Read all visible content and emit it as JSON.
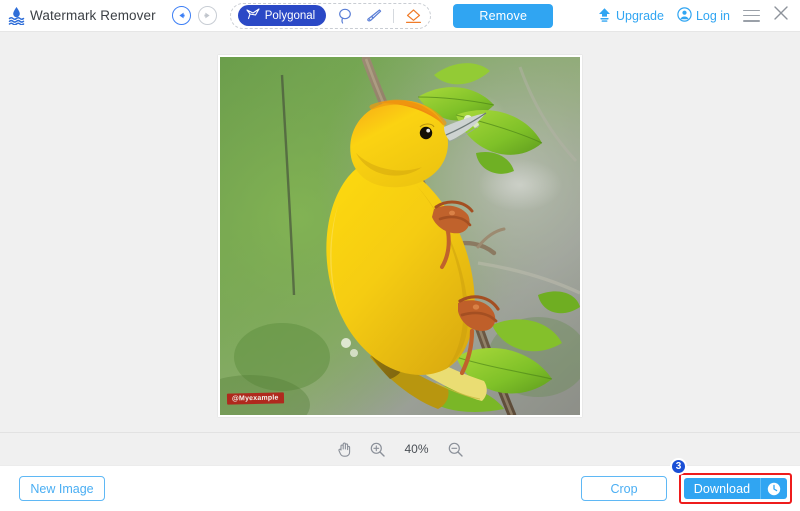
{
  "app": {
    "title": "Watermark Remover",
    "logo_icon": "water-drop-logo-icon"
  },
  "header": {
    "undo_icon": "undo-arrow-icon",
    "redo_icon": "redo-arrow-icon",
    "tools": [
      {
        "id": "polygonal",
        "label": "Polygonal",
        "icon": "polygonal-lasso-icon",
        "active": true
      },
      {
        "id": "lasso",
        "label": "",
        "icon": "lasso-icon",
        "active": false
      },
      {
        "id": "brush",
        "label": "",
        "icon": "brush-icon",
        "active": false
      },
      {
        "id": "eraser",
        "label": "",
        "icon": "eraser-icon",
        "active": false
      }
    ],
    "remove_label": "Remove",
    "upgrade_label": "Upgrade",
    "upgrade_icon": "upload-upgrade-icon",
    "login_label": "Log in",
    "login_icon": "user-account-icon",
    "menu_icon": "hamburger-menu-icon",
    "close_icon": "close-x-icon"
  },
  "canvas": {
    "image_alt": "yellow weaver bird perched on a branch with green leaves",
    "watermark_text": "@Myexample"
  },
  "zoombar": {
    "hand_icon": "hand-pan-icon",
    "zoom_in_icon": "zoom-in-icon",
    "zoom_out_icon": "zoom-out-icon",
    "zoom_level": "40%"
  },
  "footer": {
    "new_image_label": "New Image",
    "crop_label": "Crop",
    "download_label": "Download",
    "download_clock_icon": "clock-history-icon",
    "step_badge": "3"
  },
  "colors": {
    "accent_blue": "#30a5f2",
    "tool_active_blue": "#2b49c6",
    "eraser_orange": "#f07b28",
    "highlight_red": "#ee1c1c",
    "badge_blue": "#1a4fd6",
    "watermark_red": "#b52019",
    "canvas_bg": "#f0f0f0"
  }
}
